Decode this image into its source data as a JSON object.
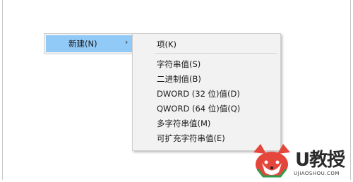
{
  "context_menu": {
    "new_item": {
      "label": "新建(N)",
      "arrow": "›"
    }
  },
  "submenu": {
    "items": [
      {
        "label": "项(K)"
      },
      {
        "label": "字符串值(S)"
      },
      {
        "label": "二进制值(B)"
      },
      {
        "label": "DWORD (32 位)值(D)"
      },
      {
        "label": "QWORD (64 位)值(Q)"
      },
      {
        "label": "多字符串值(M)"
      },
      {
        "label": "可扩充字符串值(E)"
      }
    ]
  },
  "watermark": {
    "brand": "U教授",
    "domain": "UJIAOSHOU.COM",
    "icon": "fox-logo-icon"
  },
  "colors": {
    "highlight": "#91c9f7",
    "menu_bg": "#f2f2f2"
  }
}
